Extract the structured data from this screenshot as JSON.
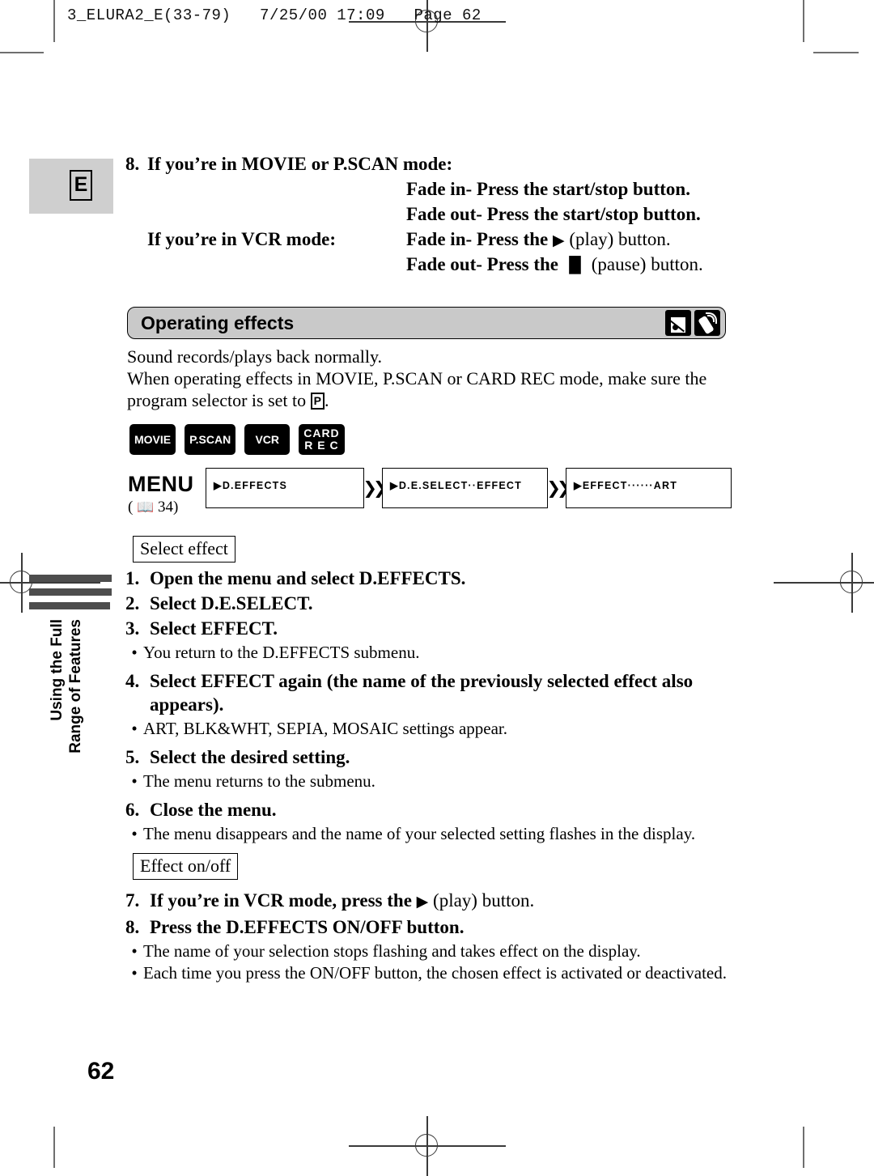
{
  "print_marks": {
    "slug": "3_ELURA2_E(33-79)   7/25/00 17:09   Page 62"
  },
  "side_tab": {
    "letter": "E",
    "vertical_line1": "Using the Full",
    "vertical_line2": "Range of Features"
  },
  "top_steps": {
    "number": "8.",
    "movie_heading": "If you’re in MOVIE or P.SCAN mode:",
    "movie_fade_in": "Fade in- Press the start/stop button.",
    "movie_fade_out": "Fade out- Press the start/stop button.",
    "vcr_heading": "If you’re in VCR mode:",
    "vcr_fade_in_pre": "Fade in- Press the",
    "vcr_fade_in_glyph": "▶",
    "vcr_fade_in_post": "(play) button.",
    "vcr_fade_out_pre": "Fade out- Press the",
    "vcr_fade_out_glyph": "▐▌",
    "vcr_fade_out_post": "(pause) button."
  },
  "banner": {
    "title": "Operating effects",
    "icon1": "card-icon",
    "icon2": "remote-control-icon"
  },
  "intro": {
    "line1": "Sound records/plays back normally.",
    "line2": "When operating effects in MOVIE, P.SCAN or CARD REC mode, make sure the",
    "line3_pre": "program selector is set to",
    "program_symbol": "P",
    "line3_post": "."
  },
  "modes": [
    {
      "label": "MOVIE",
      "label2": ""
    },
    {
      "label": "P.SCAN",
      "label2": ""
    },
    {
      "label": "VCR",
      "label2": ""
    },
    {
      "label": "CARD",
      "label2": "R E C"
    }
  ],
  "menu_flow": {
    "label": "MENU",
    "reference_pre": "(",
    "reference_glyph": "📖",
    "reference_page": "34)",
    "boxes": [
      {
        "text": "▶D.EFFECTS"
      },
      {
        "text": "▶D.E.SELECT··EFFECT"
      },
      {
        "text": "▶EFFECT······ART"
      }
    ],
    "separator": "❯❯"
  },
  "tags": {
    "select_effect": "Select effect",
    "effect_on_off": "Effect on/off"
  },
  "procedure_a": [
    {
      "n": "1.",
      "text": "Open the menu and select D.EFFECTS.",
      "bullets": []
    },
    {
      "n": "2.",
      "text": "Select D.E.SELECT.",
      "bullets": []
    },
    {
      "n": "3.",
      "text": "Select EFFECT.",
      "bullets": [
        "You return to the D.EFFECTS submenu."
      ]
    },
    {
      "n": "4.",
      "text": "Select EFFECT again (the name of the previously selected effect also appears).",
      "bullets": [
        "ART, BLK&WHT, SEPIA, MOSAIC settings appear."
      ]
    },
    {
      "n": "5.",
      "text": "Select the desired setting.",
      "bullets": [
        "The menu returns to the submenu."
      ]
    },
    {
      "n": "6.",
      "text": "Close the menu.",
      "bullets": [
        "The menu disappears and the name of your selected setting flashes in the display."
      ]
    }
  ],
  "procedure_b": [
    {
      "n": "7.",
      "text_pre": "If you’re in VCR mode, press the",
      "glyph": "▶",
      "text_post": "(play) button.",
      "bullets": []
    },
    {
      "n": "8.",
      "text_pre": "Press the D.EFFECTS ON/OFF button.",
      "glyph": "",
      "text_post": "",
      "bullets": [
        "The name of your selection stops flashing and takes effect on the display.",
        "Each time you press the ON/OFF button, the chosen effect is activated or deactivated."
      ]
    }
  ],
  "page_number": "62"
}
